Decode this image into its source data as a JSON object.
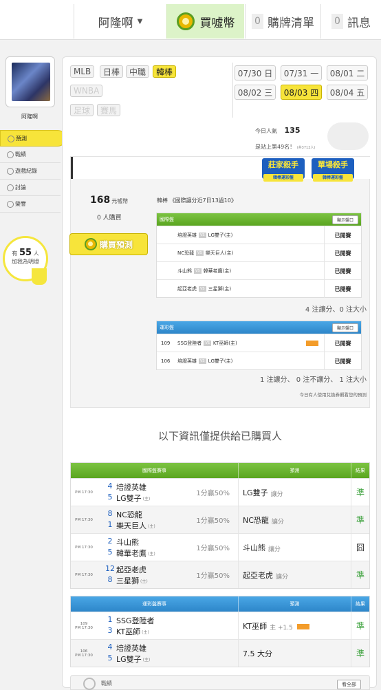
{
  "topbar": {
    "username": "阿隆啊",
    "buy_label": "買噓幣",
    "cart_count": "0",
    "cart_label": "購牌清單",
    "msg_count": "0",
    "msg_label": "訊息"
  },
  "sidebar": {
    "username": "阿隆啊",
    "items": [
      {
        "label": "預測",
        "icon": "target-icon"
      },
      {
        "label": "戰績",
        "icon": "chat-icon"
      },
      {
        "label": "遊戲紀錄",
        "icon": "record-icon"
      },
      {
        "label": "討論",
        "icon": "edit-icon"
      },
      {
        "label": "榮譽",
        "icon": "medal-icon"
      }
    ],
    "fans_prefix": "有",
    "fans_count": "55",
    "fans_suffix": "人",
    "fans_note": "加我為明燈"
  },
  "leagues": [
    "MLB",
    "日棒",
    "中職",
    "韓棒",
    "WNBA",
    "足球",
    "賽馬"
  ],
  "dates": [
    "07/30 日",
    "07/31 一",
    "08/01 二",
    "08/02 三",
    "08/03 四",
    "08/04 五"
  ],
  "popularity_label": "今日人氣",
  "popularity_value": "135",
  "rank_text": "是站上第49名！",
  "rank_note": "(共3712人)",
  "badges": [
    {
      "title": "莊家殺手",
      "sub": "韓棒運彩盤"
    },
    {
      "title": "單場殺手",
      "sub": "韓棒運彩盤"
    }
  ],
  "price_value": "168",
  "price_unit": "元噓幣",
  "buyers": "0 人購買",
  "buy_button": "購買預測",
  "pick_title": "韓棒 《國際讓分近7日13過10》",
  "intl": {
    "title": "國際盤",
    "show_label": "顯示盤口",
    "rows": [
      {
        "away": "培證英雄",
        "home": "LG雙子(主)",
        "status": "已開賽"
      },
      {
        "away": "NC恐龍",
        "home": "樂天巨人(主)",
        "status": "已開賽"
      },
      {
        "away": "斗山熊",
        "home": "韓華老鷹(主)",
        "status": "已開賽"
      },
      {
        "away": "起亞老虎",
        "home": "三星獅(主)",
        "status": "已開賽"
      }
    ],
    "summary": "4 注讓分、0 注大小"
  },
  "lottery": {
    "title": "運彩盤",
    "show_label": "顯示盤口",
    "rows": [
      {
        "no": "109",
        "away": "SSG登陸者",
        "home": "KT巫師(主)",
        "status": "已開賽"
      },
      {
        "no": "106",
        "away": "培證英雄",
        "home": "LG雙子(主)",
        "status": "已開賽"
      }
    ],
    "summary": "1 注讓分、 0 注不讓分、 1 注大小"
  },
  "note": "今日有人使用兌換券觀看您的預測",
  "info_title": "以下資訊僅提供給已購買人",
  "table1": {
    "headers": [
      "國際盤賽事",
      "預測",
      "結果"
    ],
    "rows": [
      {
        "time": "PM 17:30",
        "s1": "4",
        "t1": "培證英雄",
        "s2": "5",
        "t2": "LG雙子",
        "h": "(主)",
        "odds": "1分贏50%",
        "pred": "LG雙子",
        "type": "讓分",
        "result": "準"
      },
      {
        "time": "PM 17:30",
        "s1": "8",
        "t1": "NC恐龍",
        "s2": "1",
        "t2": "樂天巨人",
        "h": "(主)",
        "odds": "1分贏50%",
        "pred": "NC恐龍",
        "type": "讓分",
        "result": "準"
      },
      {
        "time": "PM 17:30",
        "s1": "2",
        "t1": "斗山熊",
        "s2": "5",
        "t2": "韓華老鷹",
        "h": "(主)",
        "odds": "1分贏50%",
        "pred": "斗山熊",
        "type": "讓分",
        "result": "囧"
      },
      {
        "time": "PM 17:30",
        "s1": "12",
        "t1": "起亞老虎",
        "s2": "8",
        "t2": "三星獅",
        "h": "(主)",
        "odds": "1分贏50%",
        "pred": "起亞老虎",
        "type": "讓分",
        "result": "準"
      }
    ]
  },
  "table2": {
    "headers": [
      "運彩盤賽事",
      "預測",
      "結果"
    ],
    "rows": [
      {
        "no": "109",
        "time": "PM 17:30",
        "s1": "1",
        "t1": "SSG登陸者",
        "s2": "3",
        "t2": "KT巫師",
        "h": "(主)",
        "pred": "KT巫師",
        "type": "主 +1.5",
        "result": "準"
      },
      {
        "no": "106",
        "time": "PM 17:30",
        "s1": "4",
        "t1": "培證英雄",
        "s2": "5",
        "t2": "LG雙子",
        "h": "(主)",
        "pred": "7.5 大分",
        "type": "",
        "result": "準"
      }
    ]
  },
  "bottom": {
    "label": "戰績",
    "button": "看全部"
  }
}
